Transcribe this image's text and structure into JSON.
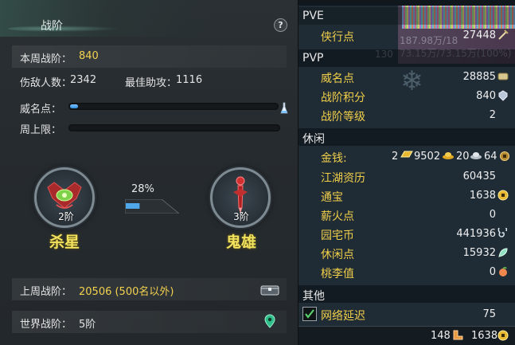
{
  "left": {
    "title": "战阶",
    "weekly_rank_label": "本周战阶：",
    "weekly_rank_value": "840",
    "injured_label": "伤敌人数：",
    "injured_value": "2342",
    "best_assist_label": "最佳助攻：",
    "best_assist_value": "1116",
    "prestige_label": "威名点：",
    "prestige_progress": 0.03,
    "weekly_cap_label": "周上限：",
    "weekly_cap_progress": 0.0,
    "current_rank": {
      "level": "2阶",
      "name": "杀星"
    },
    "next_rank": {
      "level": "3阶",
      "name": "鬼雄"
    },
    "rank_percent": "28%",
    "rank_progress": 0.28,
    "last_week_label": "上周战阶：",
    "last_week_value": "20506 (500名以外)",
    "world_rank_label": "世界战阶：",
    "world_rank_value": "5阶"
  },
  "right": {
    "pve": {
      "title": "PVE",
      "items": [
        {
          "label": "侠行点",
          "value": "27448",
          "icon": "sword-icon"
        }
      ]
    },
    "pvp": {
      "title": "PVP",
      "items": [
        {
          "label": "威名点",
          "value": "28885",
          "icon": "scroll-icon"
        },
        {
          "label": "战阶积分",
          "value": "840",
          "icon": "crest-icon"
        },
        {
          "label": "战阶等级",
          "value": "2",
          "icon": ""
        }
      ]
    },
    "leisure": {
      "title": "休闲",
      "money_label": "金钱:",
      "money": {
        "gold_bar": "2",
        "gold": "9502",
        "silver": "20",
        "copper": "64"
      },
      "items": [
        {
          "label": "江湖资历",
          "value": "60435",
          "icon": ""
        },
        {
          "label": "通宝",
          "value": "1638",
          "icon": "coin-icon"
        },
        {
          "label": "薪火点",
          "value": "0",
          "icon": ""
        },
        {
          "label": "园宅币",
          "value": "441936",
          "icon": "spiral-icon"
        },
        {
          "label": "休闲点",
          "value": "15932",
          "icon": "leaf-icon"
        },
        {
          "label": "桃李值",
          "value": "0",
          "icon": "peach-icon"
        }
      ]
    },
    "other": {
      "title": "其他",
      "latency_label": "网络延迟",
      "latency_value": "75",
      "latency_checked": true
    },
    "bottom": {
      "a": "148",
      "b": "1638"
    },
    "ghost": {
      "a": "187.98万/18",
      "b": "130",
      "c": "73.15万/73.15万(100%)"
    }
  }
}
